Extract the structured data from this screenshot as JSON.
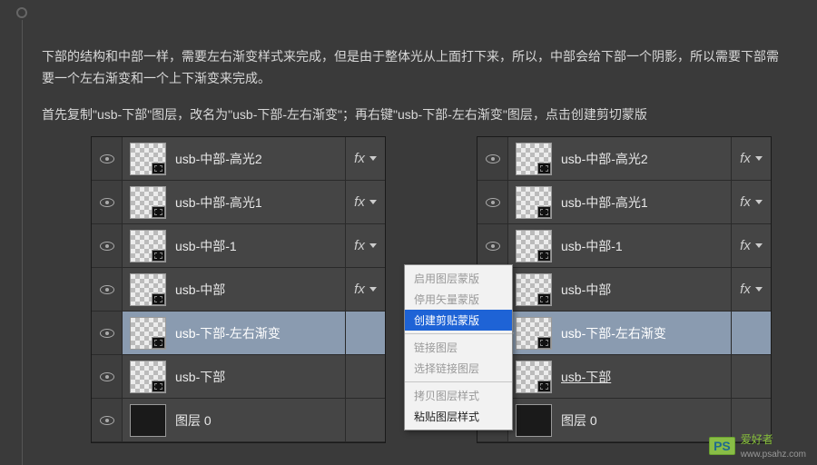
{
  "intro": {
    "p1": "下部的结构和中部一样，需要左右渐变样式来完成，但是由于整体光从上面打下来，所以，中部会给下部一个阴影，所以需要下部需要一个左右渐变和一个上下渐变来完成。",
    "p2": "首先复制\"usb-下部\"图层，改名为\"usb-下部-左右渐变\"；再右键\"usb-下部-左右渐变\"图层，点击创建剪切蒙版"
  },
  "leftPanel": {
    "layers": [
      {
        "name": "usb-中部-高光2",
        "fx": true
      },
      {
        "name": "usb-中部-高光1",
        "fx": true
      },
      {
        "name": "usb-中部-1",
        "fx": true
      },
      {
        "name": "usb-中部",
        "fx": true
      },
      {
        "name": "usb-下部-左右渐变",
        "selected": true
      },
      {
        "name": "usb-下部"
      },
      {
        "name": "图层 0",
        "solid": true
      }
    ]
  },
  "rightPanel": {
    "layers": [
      {
        "name": "usb-中部-高光2",
        "fx": true
      },
      {
        "name": "usb-中部-高光1",
        "fx": true
      },
      {
        "name": "usb-中部-1",
        "fx": true
      },
      {
        "name": "usb-中部",
        "fx": true
      },
      {
        "name": "usb-下部-左右渐变",
        "selected": true,
        "clipped": true
      },
      {
        "name": "usb-下部",
        "underlined": true
      },
      {
        "name": "图层 0",
        "solid": true
      }
    ]
  },
  "menu": {
    "items": [
      {
        "label": "启用图层蒙版",
        "disabled": true
      },
      {
        "label": "停用矢量蒙版",
        "disabled": true
      },
      {
        "label": "创建剪贴蒙版",
        "highlight": true
      },
      {
        "sep": true
      },
      {
        "label": "链接图层",
        "disabled": true
      },
      {
        "label": "选择链接图层",
        "disabled": true
      },
      {
        "sep": true
      },
      {
        "label": "拷贝图层样式",
        "disabled": true
      },
      {
        "label": "粘贴图层样式"
      }
    ]
  },
  "fx_label": "fx",
  "watermark": {
    "logo": "PS",
    "brand": "爱好者",
    "url": "www.psahz.com"
  }
}
